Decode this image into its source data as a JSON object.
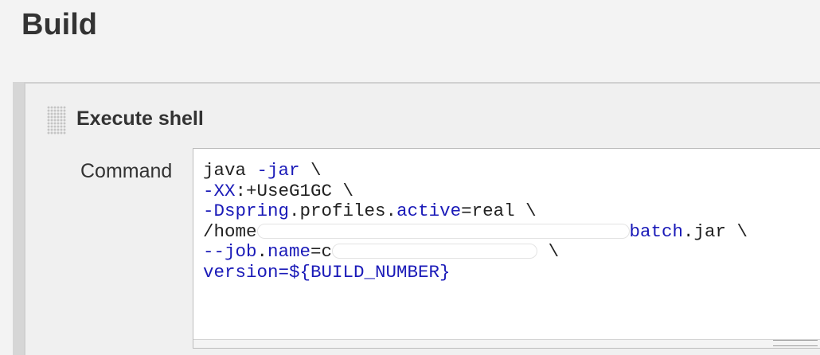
{
  "section": {
    "title": "Build"
  },
  "build_step": {
    "title": "Execute shell",
    "command_label": "Command",
    "command_lines": [
      {
        "kw": "",
        "rest": "java "
      },
      {
        "kw": "-jar",
        "rest": " \\"
      },
      {
        "kw": "-XX",
        "rest": ":+UseG1GC \\"
      },
      {
        "kw": "-Dspring",
        "rest": ".profiles."
      },
      {
        "kw": "active",
        "rest": "=real \\"
      },
      {
        "pre": "/home",
        "post_kw": "batch",
        "post": ".jar \\"
      },
      {
        "kw": "--job",
        "rest": "."
      },
      {
        "kw": "name",
        "rest": "=c"
      },
      {
        "tail": " \\"
      },
      {
        "kw": "version",
        "rest": "=${BUILD_NUMBER}"
      }
    ]
  },
  "icons": {
    "drag_handle": "drag-handle-icon",
    "resize_grip": "resize-grip-icon"
  },
  "colors": {
    "keyword": "#1a1ab8",
    "text": "#222222",
    "page_background": "#f3f3f3",
    "editor_background": "#ffffff"
  }
}
